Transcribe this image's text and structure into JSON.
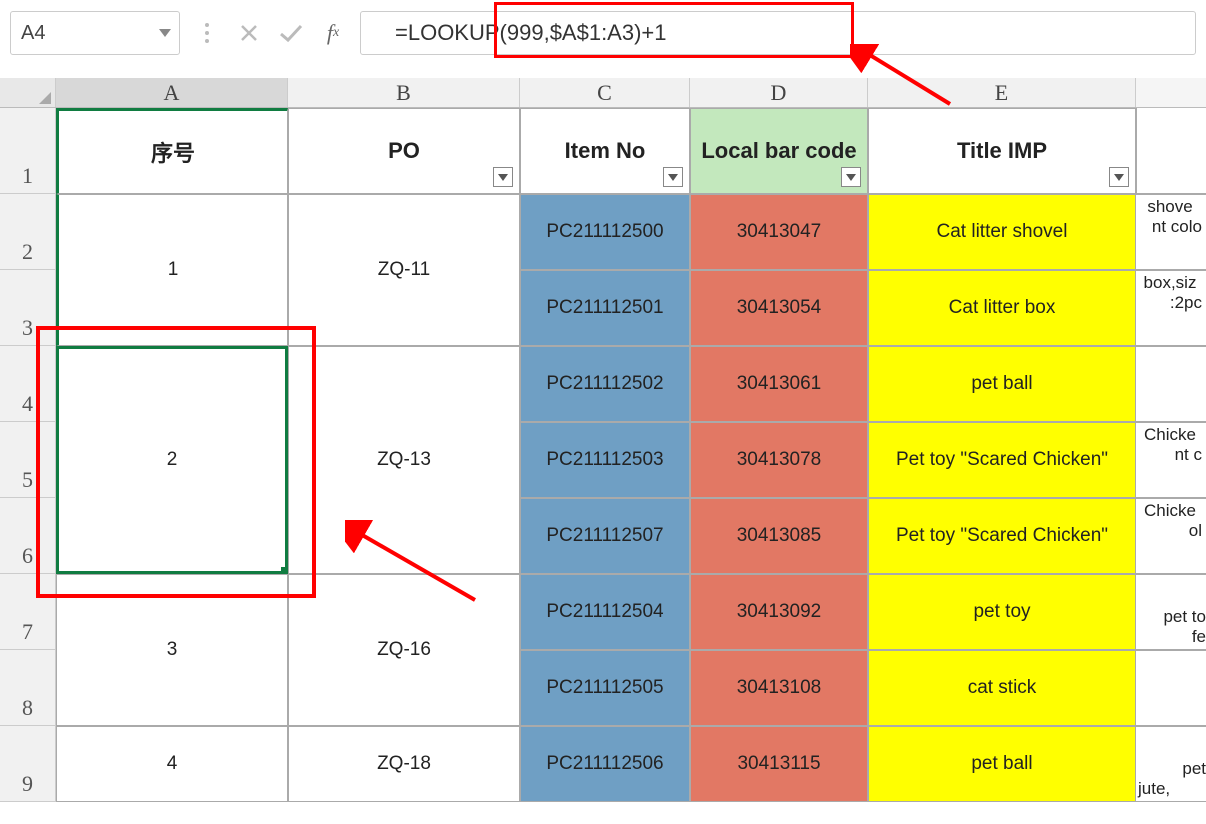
{
  "namebox": "A4",
  "formula": "=LOOKUP(999,$A$1:A3)+1",
  "columns": [
    "A",
    "B",
    "C",
    "D",
    "E"
  ],
  "headers": {
    "A": "序号",
    "B": "PO",
    "C": "Item No",
    "D": "Local bar code",
    "E": "Title IMP"
  },
  "row_heights": {
    "r1": 86,
    "r2": 76,
    "r3": 76,
    "r4": 76,
    "r5": 76,
    "r6": 76,
    "r7": 76,
    "r8": 76,
    "r9": 76
  },
  "merged": {
    "A_2_3": "1",
    "B_2_3": "ZQ-11",
    "A_4_6": "2",
    "B_4_6": "ZQ-13",
    "A_7_8": "3",
    "B_7_8": "ZQ-16",
    "A_9": "4",
    "B_9": "ZQ-18"
  },
  "itemno": {
    "r2": "PC211112500",
    "r3": "PC211112501",
    "r4": "PC211112502",
    "r5": "PC211112503",
    "r6": "PC211112507",
    "r7": "PC211112504",
    "r8": "PC211112505",
    "r9": "PC211112506"
  },
  "barcode": {
    "r2": "30413047",
    "r3": "30413054",
    "r4": "30413061",
    "r5": "30413078",
    "r6": "30413085",
    "r7": "30413092",
    "r8": "30413108",
    "r9": "30413115"
  },
  "title": {
    "r2": "Cat litter shovel",
    "r3": "Cat litter box",
    "r4": "pet ball",
    "r5": "Pet toy \"Scared Chicken\"",
    "r6": "Pet toy \"Scared Chicken\"",
    "r7": "pet toy",
    "r8": "cat stick",
    "r9": "pet ball"
  },
  "extraF": {
    "r2a": "shove",
    "r2b": "nt colo",
    "r3a": "box,siz",
    "r3b": ":2pc",
    "r5a": "Chicke",
    "r5b": "nt c",
    "r6a": "Chicke",
    "r6b": "ol",
    "r7a": "pet to",
    "r7b": "fe",
    "r9a": "pet",
    "r9b": "jute,"
  },
  "chart_data": {
    "type": "table",
    "columns": [
      "序号",
      "PO",
      "Item No",
      "Local bar code",
      "Title IMP"
    ],
    "rows": [
      [
        1,
        "ZQ-11",
        "PC211112500",
        "30413047",
        "Cat litter shovel"
      ],
      [
        1,
        "ZQ-11",
        "PC211112501",
        "30413054",
        "Cat litter box"
      ],
      [
        2,
        "ZQ-13",
        "PC211112502",
        "30413061",
        "pet ball"
      ],
      [
        2,
        "ZQ-13",
        "PC211112503",
        "30413078",
        "Pet toy \"Scared Chicken\""
      ],
      [
        2,
        "ZQ-13",
        "PC211112507",
        "30413085",
        "Pet toy \"Scared Chicken\""
      ],
      [
        3,
        "ZQ-16",
        "PC211112504",
        "30413092",
        "pet toy"
      ],
      [
        3,
        "ZQ-16",
        "PC211112505",
        "30413108",
        "cat stick"
      ],
      [
        4,
        "ZQ-18",
        "PC211112506",
        "30413115",
        "pet ball"
      ]
    ]
  }
}
